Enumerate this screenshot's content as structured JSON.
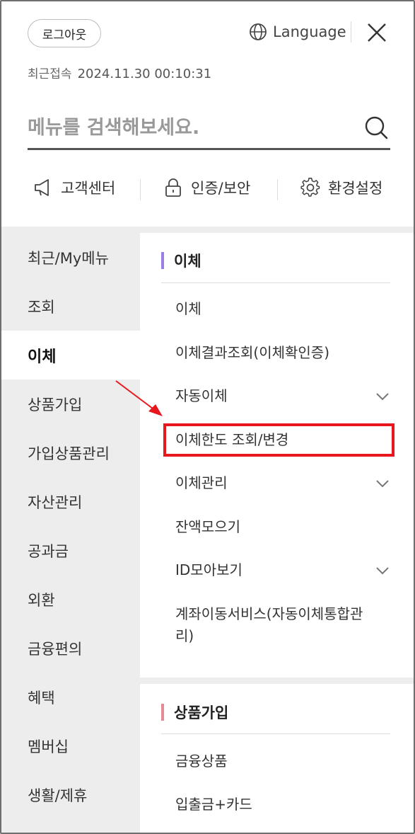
{
  "header": {
    "logout_label": "로그아웃",
    "language_label": "Language",
    "last_login_label": "최근접속",
    "last_login_value": "2024.11.30 00:10:31"
  },
  "search": {
    "placeholder": "메뉴를 검색해보세요."
  },
  "quick_links": [
    {
      "label": "고객센터",
      "icon": "megaphone-icon"
    },
    {
      "label": "인증/보안",
      "icon": "lock-icon"
    },
    {
      "label": "환경설정",
      "icon": "gear-icon"
    }
  ],
  "left_nav": {
    "items": [
      {
        "label": "최근/My메뉴"
      },
      {
        "label": "조회"
      },
      {
        "label": "이체",
        "active": true
      },
      {
        "label": "상품가입"
      },
      {
        "label": "가입상품관리"
      },
      {
        "label": "자산관리"
      },
      {
        "label": "공과금"
      },
      {
        "label": "외환"
      },
      {
        "label": "금융편의"
      },
      {
        "label": "혜택"
      },
      {
        "label": "멤버십"
      },
      {
        "label": "생활/제휴"
      }
    ]
  },
  "sections": [
    {
      "title": "이체",
      "accent": "#9b7fe6",
      "items": [
        {
          "label": "이체",
          "expandable": false
        },
        {
          "label": "이체결과조회(이체확인증)",
          "expandable": false
        },
        {
          "label": "자동이체",
          "expandable": true
        },
        {
          "label": "이체한도 조회/변경",
          "expandable": false,
          "highlighted": true
        },
        {
          "label": "이체관리",
          "expandable": true
        },
        {
          "label": "잔액모으기",
          "expandable": false
        },
        {
          "label": "ID모아보기",
          "expandable": true
        },
        {
          "label": "계좌이동서비스(자동이체통합관리)",
          "expandable": false
        }
      ]
    },
    {
      "title": "상품가입",
      "accent": "#e88a96",
      "items": [
        {
          "label": "금융상품",
          "expandable": false
        },
        {
          "label": "입출금+카드",
          "expandable": false
        }
      ]
    }
  ],
  "colors": {
    "highlight_border": "#e8161d",
    "arrow": "#e8161d",
    "nav_background": "#ededed"
  }
}
